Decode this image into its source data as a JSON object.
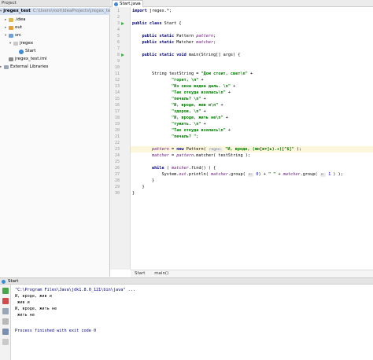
{
  "project_panel": {
    "header": "Project",
    "items": [
      {
        "label": "jregex_test",
        "path": "C:\\Users\\root\\IdeaProjects\\jregex_test",
        "icon": "module-folder-icon"
      },
      {
        "label": ".idea",
        "icon": "folder-icon"
      },
      {
        "label": "out",
        "icon": "folder-icon"
      },
      {
        "label": "src",
        "icon": "source-folder-icon"
      },
      {
        "label": "jregex",
        "icon": "package-icon"
      },
      {
        "label": "Start",
        "icon": "class-icon"
      },
      {
        "label": "jregex_test.iml",
        "icon": "iml-file-icon"
      },
      {
        "label": "External Libraries",
        "icon": "library-icon"
      }
    ]
  },
  "editor": {
    "tab_label": "Start.java",
    "tab_close": "×",
    "lines": [
      {
        "n": "1",
        "parts": [
          [
            "kw",
            "import "
          ],
          [
            "",
            "jregex.*;"
          ]
        ]
      },
      {
        "n": "2",
        "parts": []
      },
      {
        "n": "3",
        "parts": [
          [
            "kw",
            "public class "
          ],
          [
            "",
            "Start {"
          ]
        ]
      },
      {
        "n": "4",
        "parts": []
      },
      {
        "n": "5",
        "parts": [
          [
            "",
            "    "
          ],
          [
            "kw",
            "public static "
          ],
          [
            "",
            "Pattern "
          ],
          [
            "fld",
            "pattern"
          ],
          [
            "",
            ";"
          ]
        ]
      },
      {
        "n": "6",
        "parts": [
          [
            "",
            "    "
          ],
          [
            "kw",
            "public static "
          ],
          [
            "",
            "Matcher "
          ],
          [
            "fld",
            "matcher"
          ],
          [
            "",
            ";"
          ]
        ]
      },
      {
        "n": "7",
        "parts": []
      },
      {
        "n": "8",
        "parts": [
          [
            "",
            "    "
          ],
          [
            "kw",
            "public static void "
          ],
          [
            "",
            "main(String[] args) {"
          ]
        ]
      },
      {
        "n": "9",
        "parts": []
      },
      {
        "n": "10",
        "parts": []
      },
      {
        "n": "11",
        "parts": [
          [
            "",
            "        String testString = "
          ],
          [
            "str",
            "\"Дом стоит, свет\\n\""
          ],
          [
            "",
            " +"
          ]
        ]
      },
      {
        "n": "12",
        "parts": [
          [
            "",
            "                "
          ],
          [
            "str",
            "\"горит, \\n\""
          ],
          [
            "",
            " +"
          ]
        ]
      },
      {
        "n": "13",
        "parts": [
          [
            "",
            "                "
          ],
          [
            "str",
            "\"Из окна видна даль. \\n\""
          ],
          [
            "",
            " +"
          ]
        ]
      },
      {
        "n": "14",
        "parts": [
          [
            "",
            "                "
          ],
          [
            "str",
            "\"Так откуда взялась\\n\""
          ],
          [
            "",
            " +"
          ]
        ]
      },
      {
        "n": "15",
        "parts": [
          [
            "",
            "                "
          ],
          [
            "str",
            "\"печаль? \\n\""
          ],
          [
            "",
            " +"
          ]
        ]
      },
      {
        "n": "16",
        "parts": [
          [
            "",
            "                "
          ],
          [
            "str",
            "\"И, вроде, жив и\\n\""
          ],
          [
            "",
            " +"
          ]
        ]
      },
      {
        "n": "17",
        "parts": [
          [
            "",
            "                "
          ],
          [
            "str",
            "\"здоров, \\n\""
          ],
          [
            "",
            " +"
          ]
        ]
      },
      {
        "n": "18",
        "parts": [
          [
            "",
            "                "
          ],
          [
            "str",
            "\"И, вроде, жить не\\n\""
          ],
          [
            "",
            " +"
          ]
        ]
      },
      {
        "n": "19",
        "parts": [
          [
            "",
            "                "
          ],
          [
            "str",
            "\"тужить. \\n\""
          ],
          [
            "",
            " +"
          ]
        ]
      },
      {
        "n": "20",
        "parts": [
          [
            "",
            "                "
          ],
          [
            "str",
            "\"Так откуда взялась\\n\""
          ],
          [
            "",
            " +"
          ]
        ]
      },
      {
        "n": "21",
        "parts": [
          [
            "",
            "                "
          ],
          [
            "str",
            "\"печаль? \""
          ],
          [
            "",
            ";"
          ]
        ]
      },
      {
        "n": "22",
        "parts": []
      },
      {
        "n": "23",
        "parts": [
          [
            "",
            "        "
          ],
          [
            "fld",
            "pattern"
          ],
          [
            "",
            " = "
          ],
          [
            "kw",
            "new "
          ],
          [
            "",
            "Pattern( "
          ],
          [
            "hint",
            "regex:"
          ],
          [
            "str",
            " \"И, вроде, (жи[вт]ь).+)[^$]\""
          ],
          [
            "",
            " );"
          ]
        ]
      },
      {
        "n": "24",
        "parts": [
          [
            "",
            "        "
          ],
          [
            "fld",
            "matcher"
          ],
          [
            "",
            " = "
          ],
          [
            "fld",
            "pattern"
          ],
          [
            "",
            ".matcher( testString );"
          ]
        ]
      },
      {
        "n": "25",
        "parts": []
      },
      {
        "n": "26",
        "parts": [
          [
            "",
            "        "
          ],
          [
            "kw",
            "while "
          ],
          [
            "",
            "( "
          ],
          [
            "fld",
            "matcher"
          ],
          [
            "",
            ".find() ) {"
          ]
        ]
      },
      {
        "n": "27",
        "parts": [
          [
            "",
            "            System."
          ],
          [
            "fld",
            "out"
          ],
          [
            "",
            ".println( "
          ],
          [
            "fld",
            "matcher"
          ],
          [
            "",
            ".group( "
          ],
          [
            "hint",
            "n:"
          ],
          [
            "num",
            " 0"
          ],
          [
            "",
            ") + "
          ],
          [
            "str",
            "\" \""
          ],
          [
            "",
            " + "
          ],
          [
            "fld",
            "matcher"
          ],
          [
            "",
            ".group( "
          ],
          [
            "hint",
            "n:"
          ],
          [
            "num",
            " 1"
          ],
          [
            "",
            " ) );"
          ]
        ]
      },
      {
        "n": "28",
        "parts": [
          [
            "",
            "        }"
          ]
        ]
      },
      {
        "n": "29",
        "parts": [
          [
            "",
            "    }"
          ]
        ]
      },
      {
        "n": "30",
        "parts": [
          [
            "",
            "}"
          ]
        ]
      }
    ],
    "highlight_line": "23"
  },
  "breadcrumb": {
    "item1": "Start",
    "item2": "main()"
  },
  "run_panel": {
    "tab_label": "Start",
    "output": [
      {
        "text": "\"C:\\Program Files\\Java\\jdk1.8.0_121\\bin\\java\" ...",
        "kind": "cmd"
      },
      {
        "text": "И, вроде, жив и",
        "kind": "out"
      },
      {
        "text": " жив и",
        "kind": "out"
      },
      {
        "text": "И, вроде, жить не",
        "kind": "out"
      },
      {
        "text": " жить не",
        "kind": "out"
      },
      {
        "text": "",
        "kind": "out"
      },
      {
        "text": "Process finished with exit code 0",
        "kind": "exit"
      }
    ]
  },
  "colors": {
    "keyword": "#000080",
    "string": "#008000",
    "field": "#660e7a",
    "highlight": "#fbf6dc",
    "selection": "#d5e1f2"
  }
}
